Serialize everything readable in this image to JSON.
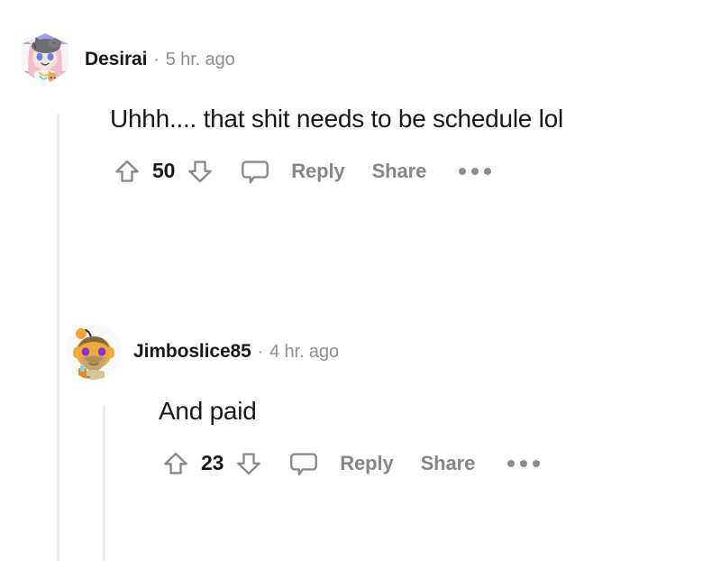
{
  "theme": {
    "background": "#ffffff",
    "text_primary": "#16181a",
    "text_muted": "#8b8e90",
    "action_label": "#82878b",
    "icon_stroke": "#878a8c",
    "thread_line": "#ebecef"
  },
  "comments": [
    {
      "id": "comment-desirai",
      "depth": 0,
      "author": "Desirai",
      "separator": "·",
      "timestamp": "5 hr. ago",
      "body": "Uhhh.... that shit needs to be schedule lol",
      "avatar": {
        "name": "avatar-desirai",
        "style": "hexagon-nft",
        "description": "Snoo with pink hair, gray cat hat and small cat"
      },
      "actions": {
        "upvote_icon": "upvote-arrow-icon",
        "downvote_icon": "downvote-arrow-icon",
        "comment_icon": "comment-bubble-icon",
        "score": "50",
        "reply_label": "Reply",
        "share_label": "Share",
        "overflow_icon": "overflow-dots-icon"
      }
    },
    {
      "id": "comment-jimboslice85",
      "depth": 1,
      "author": "Jimboslice85",
      "separator": "·",
      "timestamp": "4 hr. ago",
      "body": "And paid",
      "avatar": {
        "name": "avatar-jimboslice85",
        "style": "circle",
        "description": "Orange Snoo with purple eyes, beard and mustache"
      },
      "actions": {
        "upvote_icon": "upvote-arrow-icon",
        "downvote_icon": "downvote-arrow-icon",
        "comment_icon": "comment-bubble-icon",
        "score": "23",
        "reply_label": "Reply",
        "share_label": "Share",
        "overflow_icon": "overflow-dots-icon"
      }
    }
  ]
}
